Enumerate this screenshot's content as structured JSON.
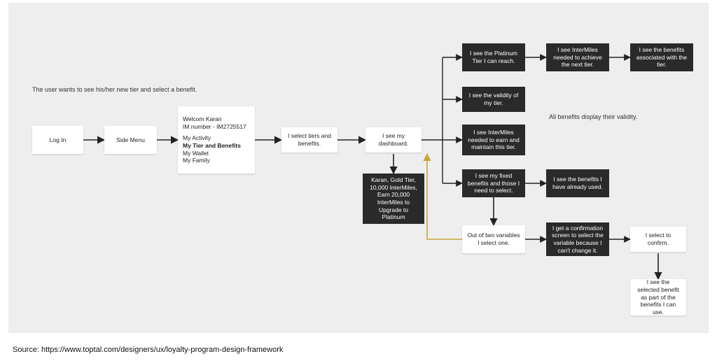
{
  "annotations": {
    "intro": "The user wants to see his/her new tier and select a benefit.",
    "benefits_validity": "All benefits display their validity."
  },
  "nodes": {
    "login": "Log In",
    "side_menu": "Side Menu",
    "profile": {
      "line1": "Welcom Karan",
      "line2": "IM number - IM2725517",
      "item1": "My Activity",
      "item2": "My Tier and Benefits",
      "item3": "My Wallet",
      "item4": "My Family"
    },
    "select_tiers": "I select tiers and benefits.",
    "dashboard": "I see my dashboard.",
    "dashboard_detail": "Karan, Gold Tier, 10,000 InterMiles, Earn 20,000 InterMiles to Upgrade to Platinum",
    "platinum": "I see the Platinum Tier I can reach.",
    "miles_next": "I see InterMiles needed to achieve the next tier.",
    "benefits_tier": "I see the benefits associated with the tier.",
    "validity": "I see the validity of my tier.",
    "maintain": "I see InterMiles needed to earn and maintain this tier.",
    "fixed_benefits": "I see my fixed benefits and those I need to select.",
    "benefits_used": "I see the benefits I have already used.",
    "select_one": "Out of two variables I select one.",
    "confirmation": "I get a confirmation screen to select the variable because I can't change it.",
    "confirm": "I select to confirm.",
    "selected_benefit": "I see the selected benefit as part of the benefits I can use."
  },
  "source": "Source: https://www.toptal.com/designers/ux/loyalty-program-design-framework"
}
